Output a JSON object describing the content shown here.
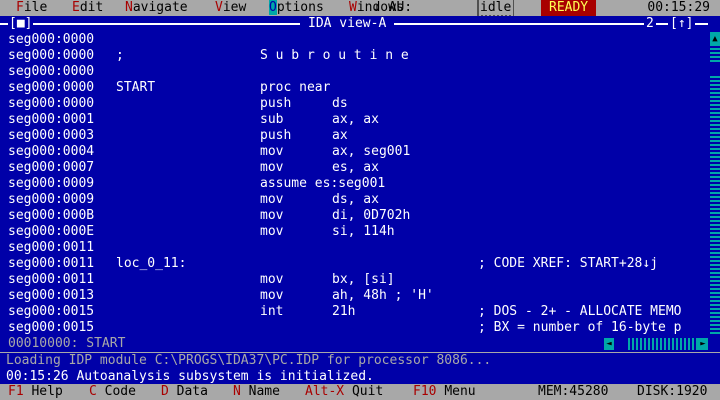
{
  "menubar": {
    "items": [
      {
        "hot": "F",
        "rest": "ile"
      },
      {
        "hot": "E",
        "rest": "dit"
      },
      {
        "hot": "N",
        "rest": "avigate"
      },
      {
        "hot": "V",
        "rest": "iew"
      },
      {
        "hot": "O",
        "rest": "ptions"
      },
      {
        "hot": "W",
        "rest": "indows"
      }
    ],
    "au_label": "↓ AU:",
    "idle_status": "idle",
    "ready_status": "READY",
    "clock": "00:15:29"
  },
  "window": {
    "close_box": "[■]",
    "title": "IDA view-A",
    "number": "2",
    "zoom_box": "[↑]"
  },
  "listing": [
    {
      "addr": "seg000:0000",
      "label": "",
      "mnemonic": "",
      "operands": "",
      "comment": ""
    },
    {
      "addr": "seg000:0000",
      "label": ";",
      "mnemonic": "S u b r o u t i n e",
      "operands": "",
      "comment": ""
    },
    {
      "addr": "seg000:0000",
      "label": "",
      "mnemonic": "",
      "operands": "",
      "comment": ""
    },
    {
      "addr": "seg000:0000",
      "label": "START",
      "mnemonic": "proc near",
      "operands": "",
      "comment": ""
    },
    {
      "addr": "seg000:0000",
      "label": "",
      "mnemonic": "push",
      "operands": "ds",
      "comment": ""
    },
    {
      "addr": "seg000:0001",
      "label": "",
      "mnemonic": "sub",
      "operands": "ax, ax",
      "comment": ""
    },
    {
      "addr": "seg000:0003",
      "label": "",
      "mnemonic": "push",
      "operands": "ax",
      "comment": ""
    },
    {
      "addr": "seg000:0004",
      "label": "",
      "mnemonic": "mov",
      "operands": "ax, seg001",
      "comment": ""
    },
    {
      "addr": "seg000:0007",
      "label": "",
      "mnemonic": "mov",
      "operands": "es, ax",
      "comment": ""
    },
    {
      "addr": "seg000:0009",
      "label": "",
      "mnemonic": "assume es:seg001",
      "operands": "",
      "comment": ""
    },
    {
      "addr": "seg000:0009",
      "label": "",
      "mnemonic": "mov",
      "operands": "ds, ax",
      "comment": ""
    },
    {
      "addr": "seg000:000B",
      "label": "",
      "mnemonic": "mov",
      "operands": "di, 0D702h",
      "comment": ""
    },
    {
      "addr": "seg000:000E",
      "label": "",
      "mnemonic": "mov",
      "operands": "si, 114h",
      "comment": ""
    },
    {
      "addr": "seg000:0011",
      "label": "",
      "mnemonic": "",
      "operands": "",
      "comment": ""
    },
    {
      "addr": "seg000:0011",
      "label": "loc_0_11:",
      "mnemonic": "",
      "operands": "",
      "comment": "; CODE XREF: START+28↓j"
    },
    {
      "addr": "seg000:0011",
      "label": "",
      "mnemonic": "mov",
      "operands": "bx, [si]",
      "comment": ""
    },
    {
      "addr": "seg000:0013",
      "label": "",
      "mnemonic": "mov",
      "operands": "ah, 48h ; 'H'",
      "comment": ""
    },
    {
      "addr": "seg000:0015",
      "label": "",
      "mnemonic": "int",
      "operands": "21h",
      "comment": "; DOS - 2+ - ALLOCATE MEMO"
    },
    {
      "addr": "seg000:0015",
      "label": "",
      "mnemonic": "",
      "operands": "",
      "comment": "; BX = number of 16-byte p"
    }
  ],
  "seg_indicator": "00010000: START",
  "messages": {
    "line1": "Loading IDP module C:\\PROGS\\IDA37\\PC.IDP for processor 8086...",
    "line2": "00:15:26 Autoanalysis subsystem is initialized."
  },
  "fnbar": {
    "keys": [
      {
        "key": "F1",
        "label": "Help"
      },
      {
        "key": "C",
        "label": "Code"
      },
      {
        "key": "D",
        "label": "Data"
      },
      {
        "key": "N",
        "label": "Name"
      },
      {
        "key": "Alt-X",
        "label": "Quit"
      },
      {
        "key": "F10",
        "label": "Menu"
      }
    ],
    "mem": "MEM:45280",
    "disk": "DISK:1920"
  }
}
